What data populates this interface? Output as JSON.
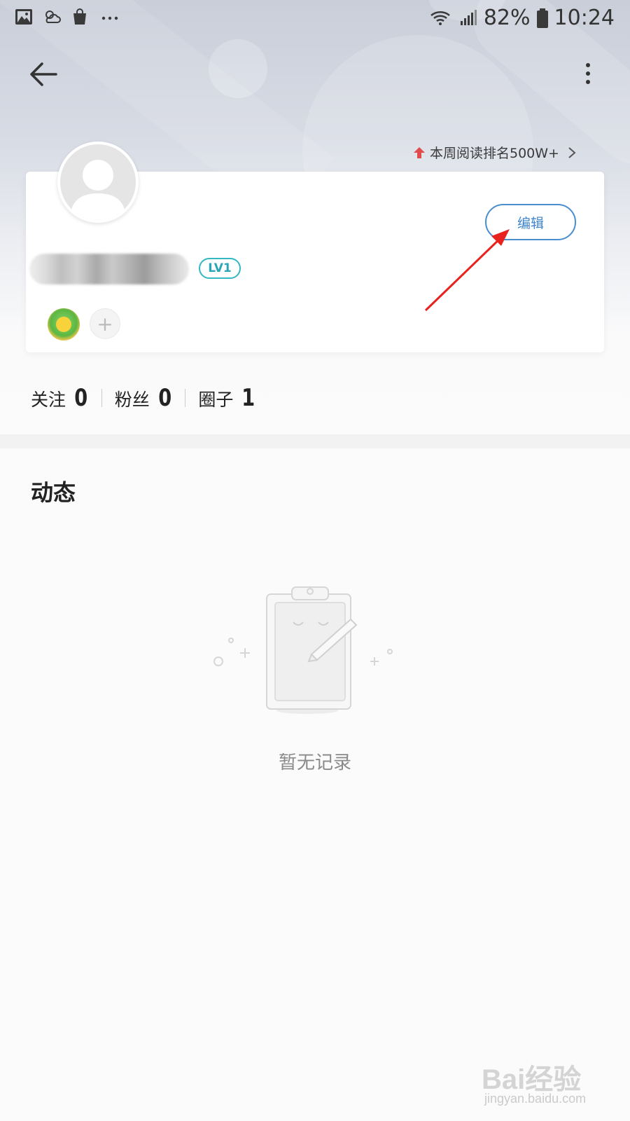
{
  "status_bar": {
    "battery": "82%",
    "time": "10:24"
  },
  "header": {
    "weekly_rank": "本周阅读排名500W+"
  },
  "profile": {
    "edit_label": "编辑",
    "level": "LV1"
  },
  "stats": [
    {
      "label": "关注",
      "value": "0"
    },
    {
      "label": "粉丝",
      "value": "0"
    },
    {
      "label": "圈子",
      "value": "1"
    }
  ],
  "activity": {
    "title": "动态",
    "empty_text": "暂无记录"
  },
  "watermark": {
    "brand": "Bai经验",
    "url": "jingyan.baidu.com"
  },
  "colors": {
    "accent_blue": "#4a8ed0",
    "level_teal": "#35b7c4",
    "rank_red": "#e24b4b"
  }
}
